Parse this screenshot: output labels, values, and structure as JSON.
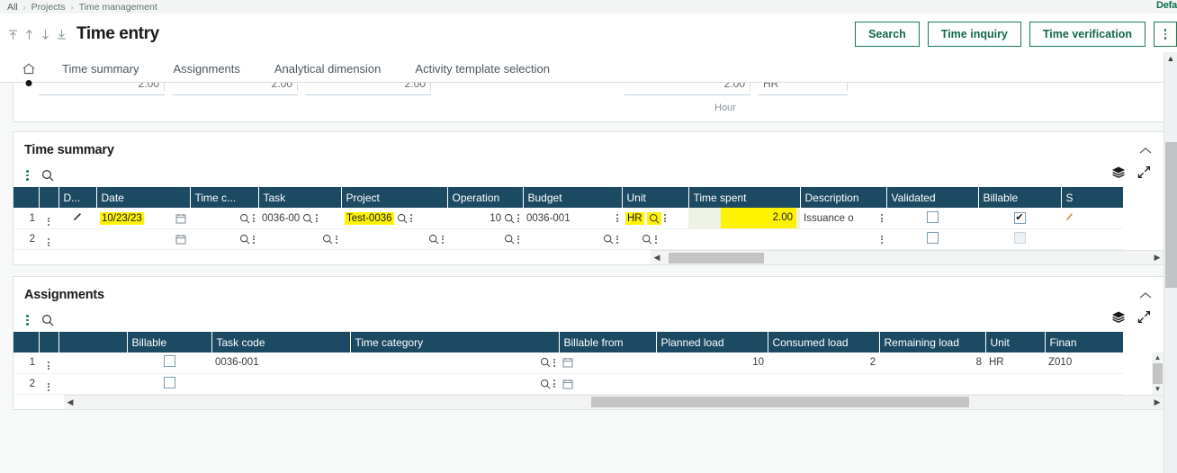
{
  "breadcrumb": {
    "items": [
      "All",
      "Projects",
      "Time management"
    ],
    "separator": "›",
    "right_label": "Defa"
  },
  "header": {
    "title": "Time entry",
    "nav_arrows": [
      "first-record-arrow",
      "previous-record-arrow",
      "next-record-arrow",
      "last-record-arrow"
    ],
    "buttons": [
      {
        "label": "Search",
        "name": "search-button"
      },
      {
        "label": "Time inquiry",
        "name": "time-inquiry-button"
      },
      {
        "label": "Time verification",
        "name": "time-verification-button"
      }
    ],
    "overflow_menu": "more-options-button"
  },
  "tabs": [
    {
      "label": "Time summary",
      "name": "tab-time-summary"
    },
    {
      "label": "Assignments",
      "name": "tab-assignments"
    },
    {
      "label": "Analytical dimension",
      "name": "tab-analytical-dimension"
    },
    {
      "label": "Activity template selection",
      "name": "tab-activity-template-selection"
    }
  ],
  "cut_panel": {
    "values": [
      "2.00",
      "2.00",
      "2.00",
      "2.00"
    ],
    "unit_value": "HR",
    "unit_label": "Hour"
  },
  "time_summary": {
    "title": "Time summary",
    "columns": [
      "",
      "",
      "D...",
      "Date",
      "Time c...",
      "Task",
      "Project",
      "Operation",
      "Budget",
      "Unit",
      "Time spent",
      "Description",
      "Validated",
      "Billable",
      "S"
    ],
    "rows": [
      {
        "num": "1",
        "date": "10/23/23",
        "time_category": "",
        "task": "0036-00",
        "project": "Test-0036",
        "operation": "10",
        "budget": "0036-001",
        "unit": "HR",
        "time_spent": "2.00",
        "description": "Issuance o",
        "validated": false,
        "billable": true
      },
      {
        "num": "2",
        "date": "",
        "time_category": "",
        "task": "",
        "project": "",
        "operation": "",
        "budget": "",
        "unit": "",
        "time_spent": "",
        "description": "",
        "validated": false,
        "billable": false
      }
    ]
  },
  "assignments": {
    "title": "Assignments",
    "columns": [
      "",
      "",
      "",
      "Billable",
      "Task code",
      "Time category",
      "Billable from",
      "Planned load",
      "Consumed load",
      "Remaining load",
      "Unit",
      "Finan"
    ],
    "rows": [
      {
        "num": "1",
        "billable": false,
        "task_code": "0036-001",
        "time_category": "",
        "billable_from": "",
        "planned_load": "10",
        "consumed_load": "2",
        "remaining_load": "8",
        "unit": "HR",
        "financial": "Z010"
      },
      {
        "num": "2",
        "billable": false,
        "task_code": "",
        "time_category": "",
        "billable_from": "",
        "planned_load": "",
        "consumed_load": "",
        "remaining_load": "",
        "unit": "",
        "financial": ""
      }
    ]
  },
  "colors": {
    "header_blue": "#1c4a63",
    "accent_green": "#12684a",
    "highlight_yellow": "#fff200",
    "highlight_green": "#9ef29e"
  }
}
